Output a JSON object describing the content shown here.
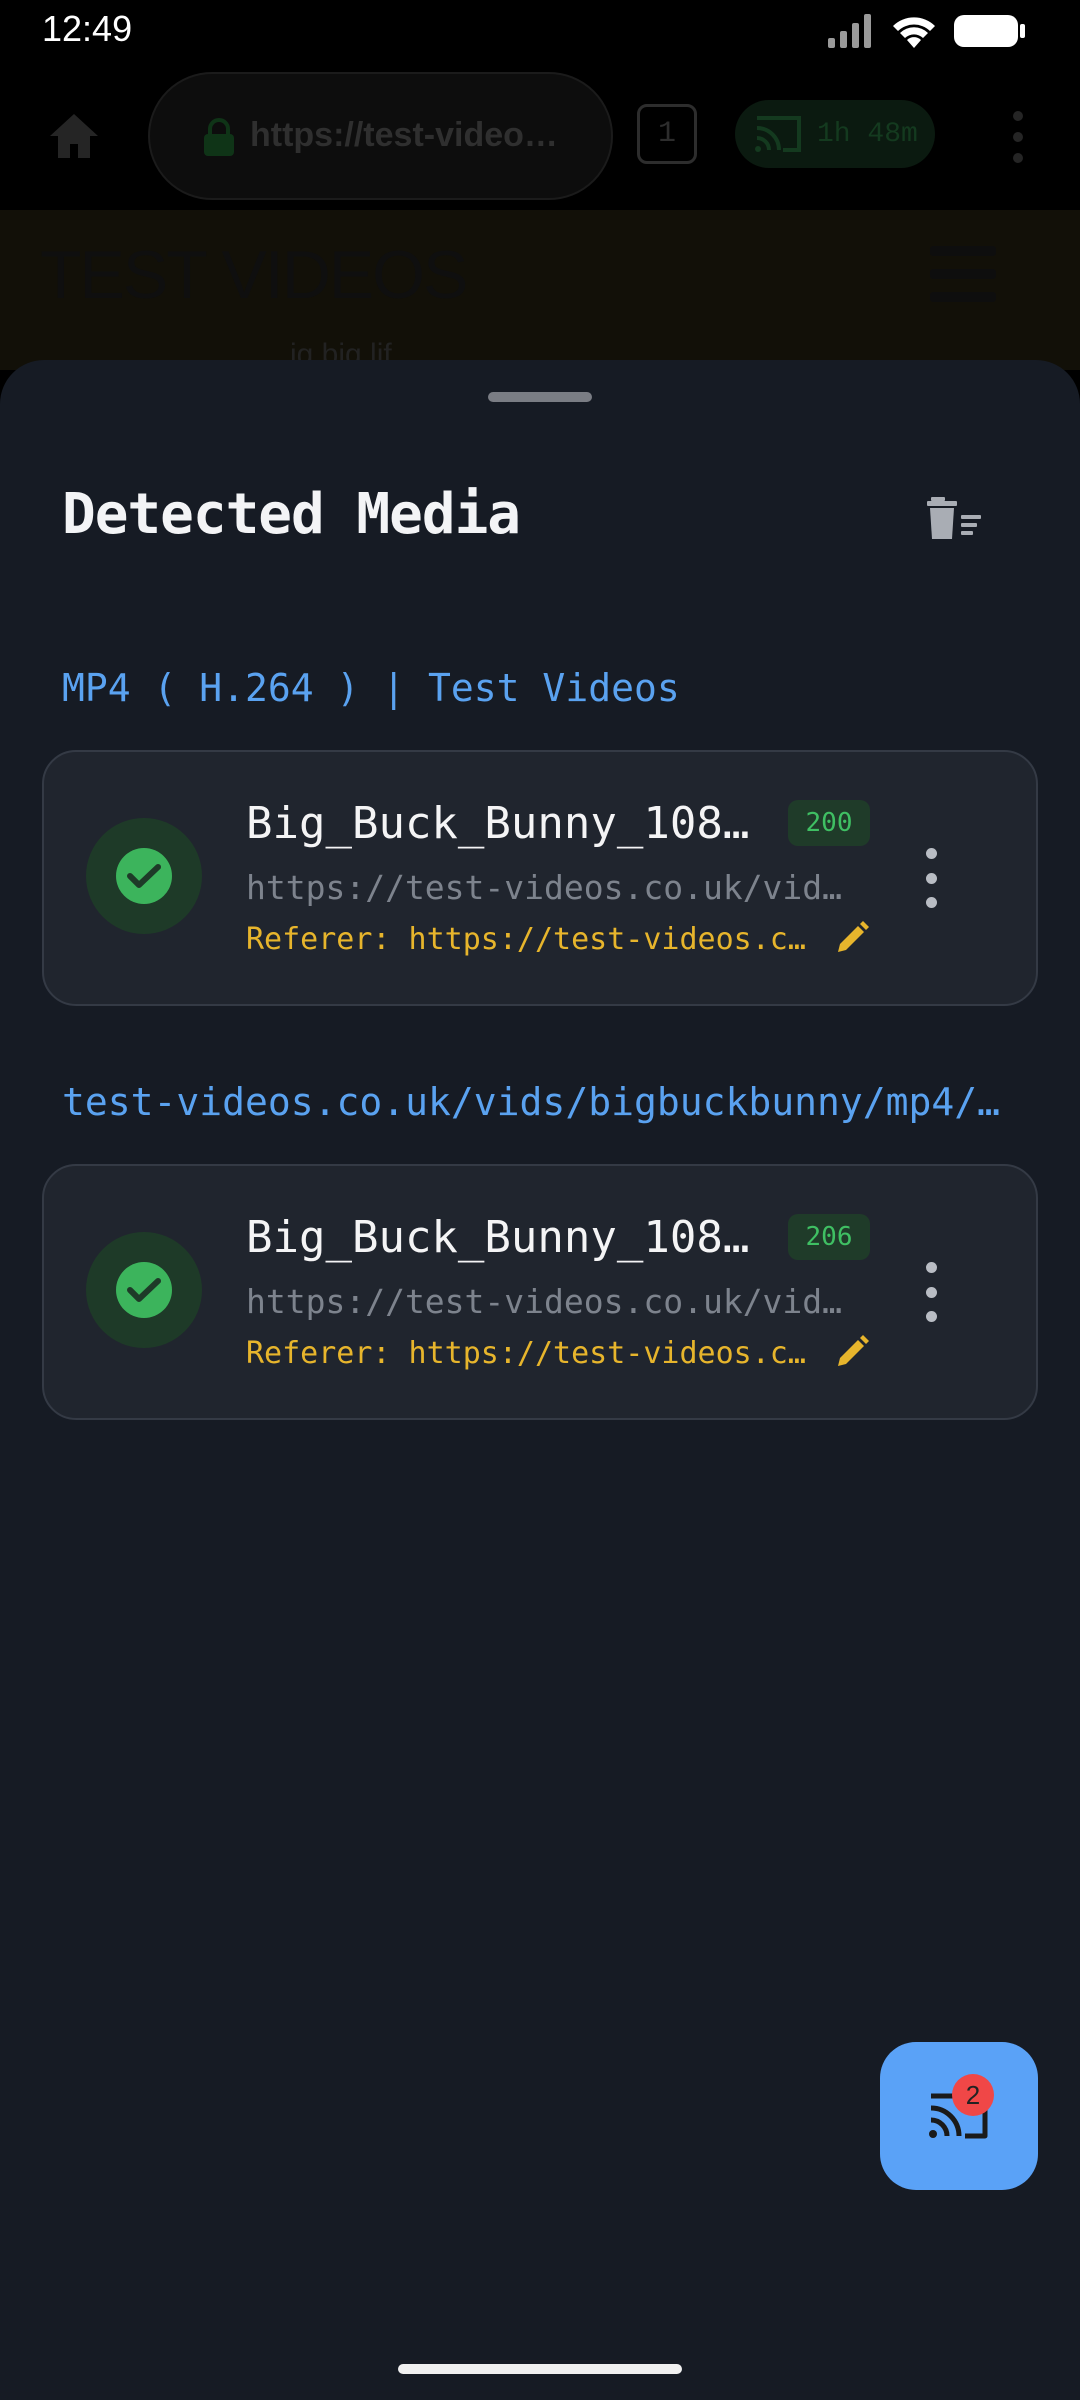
{
  "status_bar": {
    "time": "12:49"
  },
  "browser": {
    "url": "https://test-video…",
    "tab_count": "1",
    "cast_timer": "1h 48m"
  },
  "website": {
    "title": "TEST VIDEOS",
    "subtitle_fragment": "ig big lif"
  },
  "sheet": {
    "title": "Detected Media",
    "groups": [
      {
        "header": "MP4 ( H.264 ) | Test Videos",
        "item": {
          "name": "Big_Buck_Bunny_1080…",
          "status_code": "200",
          "url": "https://test-videos.co.uk/vids…",
          "referer": "Referer: https://test-videos.c…"
        }
      },
      {
        "header": "test-videos.co.uk/vids/bigbuckbunny/mp4/…",
        "item": {
          "name": "Big_Buck_Bunny_1080…",
          "status_code": "206",
          "url": "https://test-videos.co.uk/vids…",
          "referer": "Referer: https://test-videos.c…"
        }
      }
    ]
  },
  "fab": {
    "badge_count": "2"
  },
  "colors": {
    "sheet_bg": "#161b24",
    "accent_blue": "#5aa2f0",
    "success_green": "#3cb45c",
    "referer_yellow": "#e7b52c",
    "badge_red": "#f04747"
  },
  "icons": {
    "home": "home-icon",
    "lock": "lock-icon",
    "cast": "cast-icon",
    "clear": "clear-all-icon",
    "check": "check-circle-icon",
    "edit": "pencil-icon",
    "more": "more-vert-icon"
  }
}
